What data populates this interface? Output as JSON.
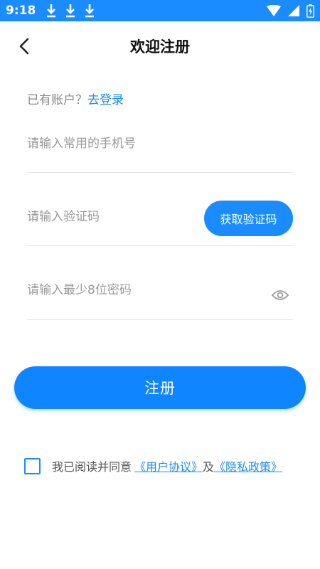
{
  "status_bar": {
    "time": "9:18",
    "download_icons": [
      "download-icon",
      "download-icon",
      "download-icon"
    ]
  },
  "header": {
    "title": "欢迎注册",
    "back_icon": "chevron-left-icon"
  },
  "login_hint": {
    "text": "已有账户？",
    "link": "去登录"
  },
  "form": {
    "phone_placeholder": "请输入常用的手机号",
    "code_placeholder": "请输入验证码",
    "get_code_button": "获取验证码",
    "password_placeholder": "请输入最少8位密码",
    "eye_icon": "eye-icon"
  },
  "register_button": "注册",
  "agreement": {
    "prefix": "我已阅读并同意",
    "user_agreement": "《用户协议》",
    "and": "及",
    "privacy_policy": "《隐私政策》"
  },
  "colors": {
    "accent": "#1a8cff",
    "status_bar": "#1a8cff",
    "text_muted": "#9a9a9a"
  }
}
